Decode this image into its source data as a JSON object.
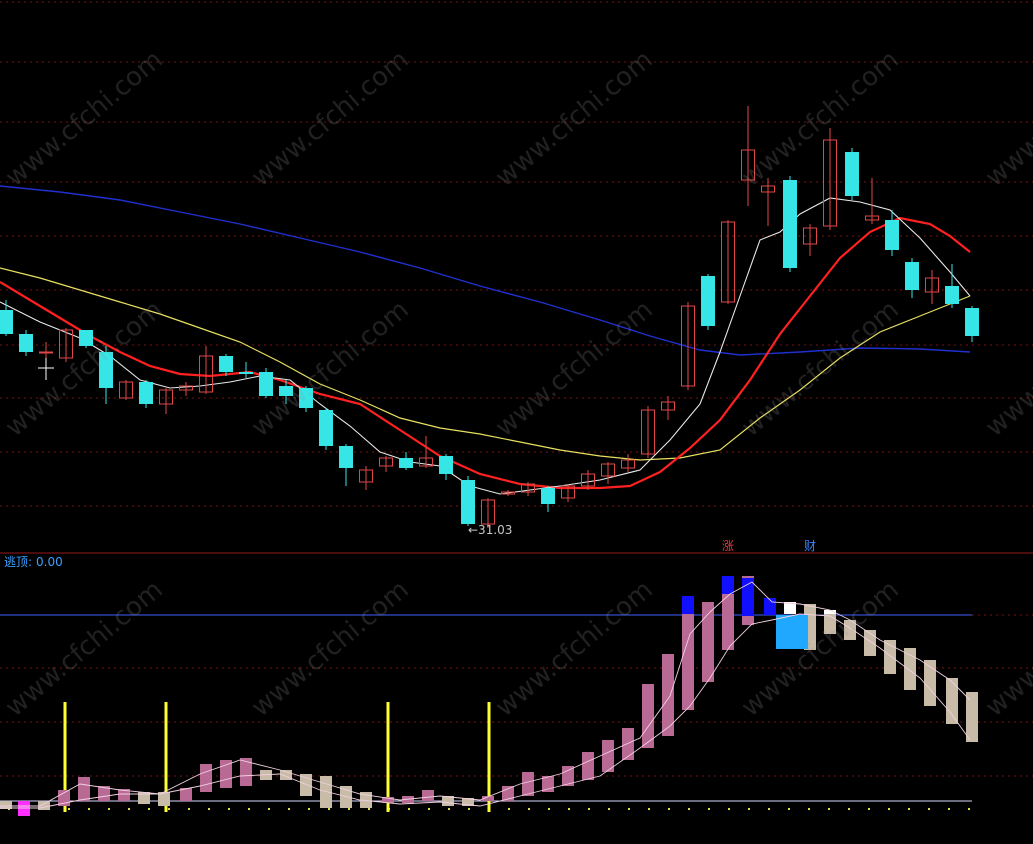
{
  "indicator": {
    "name": "逃顶:",
    "value": "0.00"
  },
  "low_marker": {
    "text": "←31.03"
  },
  "badges": {
    "zhang": "涨",
    "cai": "财"
  },
  "watermark": "www.cfchi.com",
  "colors": {
    "background": "#000000",
    "up_candle": "#e04848",
    "down_candle": "#36e6e6",
    "ma_white": "#e8e8e8",
    "ma_red": "#ff2020",
    "ma_yellow": "#e8e060",
    "ma_blue": "#2030d0",
    "ind_pink": "#b86a94",
    "ind_gray": "#c8bca8",
    "ind_blue": "#1010ff",
    "ind_sky": "#20a8ff",
    "ind_yellow": "#ffff30",
    "ref_line": "#4060ff"
  }
}
